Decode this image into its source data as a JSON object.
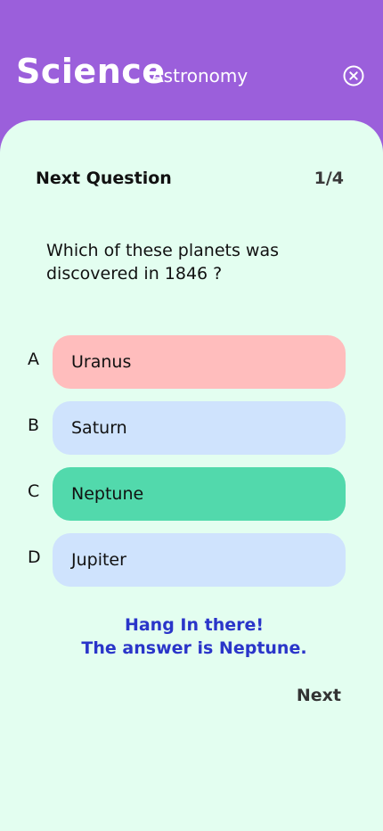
{
  "header": {
    "title": "Science",
    "subtitle": "Astronomy",
    "close_icon": "close-circle-icon"
  },
  "quiz": {
    "next_question_label": "Next Question",
    "counter": "1/4",
    "question": "Which of these planets was discovered in 1846 ?",
    "options": [
      {
        "letter": "A",
        "text": "Uranus",
        "state": "incorrect"
      },
      {
        "letter": "B",
        "text": "Saturn",
        "state": "neutral"
      },
      {
        "letter": "C",
        "text": "Neptune",
        "state": "correct"
      },
      {
        "letter": "D",
        "text": "Jupiter",
        "state": "neutral"
      }
    ],
    "feedback_line1": "Hang In there!",
    "feedback_line2": "The answer is Neptune.",
    "next_label": "Next"
  },
  "colors": {
    "header_bg": "#9b5fdb",
    "card_bg": "#e3fef0",
    "incorrect": "#ffbdbd",
    "neutral": "#cfe3fd",
    "correct": "#52d9ac",
    "feedback": "#2a35c9"
  }
}
